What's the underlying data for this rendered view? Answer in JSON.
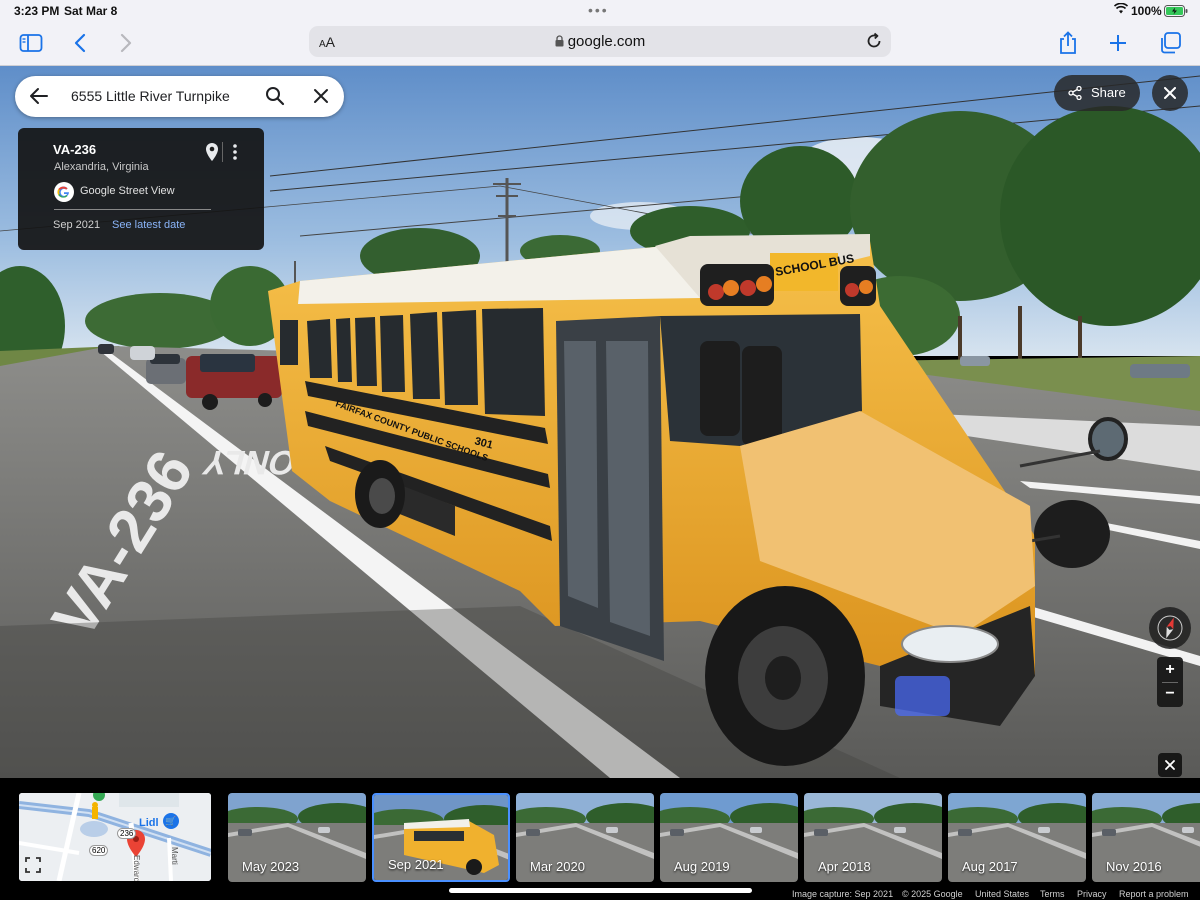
{
  "status_bar": {
    "time": "3:23 PM",
    "date": "Sat Mar 8",
    "battery": "100%"
  },
  "browser": {
    "text_size_label": "AA",
    "url": "google.com"
  },
  "search": {
    "query": "6555 Little River Turnpike"
  },
  "info_card": {
    "title": "VA-236",
    "subtitle": "Alexandria, Virginia",
    "source": "Google Street View",
    "date": "Sep 2021",
    "latest_link": "See latest date"
  },
  "share_label": "Share",
  "zoom": {
    "in": "+",
    "out": "−"
  },
  "scene_text": {
    "bus_sign": "SCHOOL BUS",
    "bus_side": "FAIRFAX COUNTY PUBLIC SCHOOLS",
    "bus_number": "301",
    "road_mark_1": "VA-236",
    "road_mark_2": "ONLY"
  },
  "minimap": {
    "poi": "Lidl",
    "shield_1": "236",
    "shield_2": "620",
    "road_1": "Edward",
    "road_2": "Marti"
  },
  "timeline": [
    {
      "label": "May 2023",
      "selected": false
    },
    {
      "label": "Sep 2021",
      "selected": true
    },
    {
      "label": "Mar 2020",
      "selected": false
    },
    {
      "label": "Aug 2019",
      "selected": false
    },
    {
      "label": "Apr 2018",
      "selected": false
    },
    {
      "label": "Aug 2017",
      "selected": false
    },
    {
      "label": "Nov 2016",
      "selected": false
    }
  ],
  "footer": {
    "capture": "Image capture: Sep 2021",
    "copyright": "© 2025 Google",
    "country": "United States",
    "terms": "Terms",
    "privacy": "Privacy",
    "report": "Report a problem"
  },
  "colors": {
    "accent": "#1a73e8",
    "selected_border": "#4a90ff",
    "bus_yellow": "#f0b12e"
  }
}
